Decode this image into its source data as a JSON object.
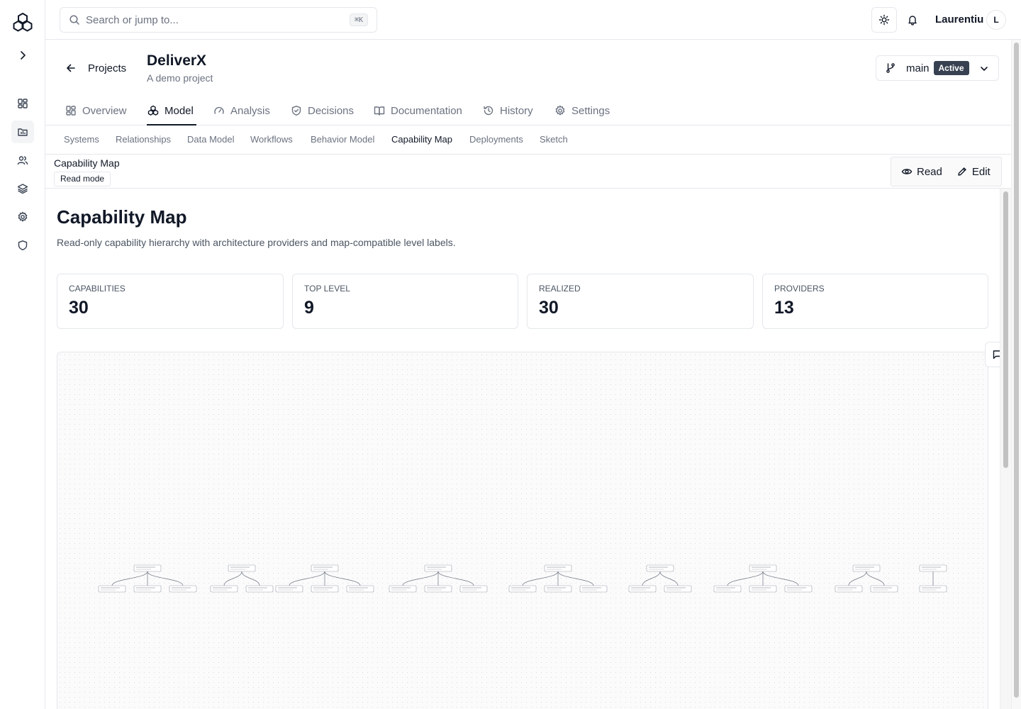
{
  "search": {
    "placeholder": "Search or jump to...",
    "shortcut": "⌘K"
  },
  "user": {
    "name": "Laurentiu",
    "initial": "L"
  },
  "breadcrumb": {
    "back_label": "Projects"
  },
  "project": {
    "name": "DeliverX",
    "description": "A demo project"
  },
  "branch": {
    "name": "main",
    "status": "Active"
  },
  "tabs": [
    {
      "label": "Overview",
      "icon": "layout-icon"
    },
    {
      "label": "Model",
      "icon": "boxes-icon",
      "active": true
    },
    {
      "label": "Analysis",
      "icon": "gauge-icon"
    },
    {
      "label": "Decisions",
      "icon": "shield-check-icon"
    },
    {
      "label": "Documentation",
      "icon": "book-icon"
    },
    {
      "label": "History",
      "icon": "history-icon"
    },
    {
      "label": "Settings",
      "icon": "gear-icon"
    }
  ],
  "subtabs": [
    {
      "label": "Systems"
    },
    {
      "label": "Relationships"
    },
    {
      "label": "Data Model"
    },
    {
      "label": "Workflows"
    },
    {
      "label": "Behavior Model"
    },
    {
      "label": "Capability Map",
      "active": true
    },
    {
      "label": "Deployments"
    },
    {
      "label": "Sketch"
    }
  ],
  "capbar": {
    "title": "Capability Map",
    "mode_badge": "Read mode",
    "read_label": "Read",
    "edit_label": "Edit"
  },
  "page": {
    "title": "Capability Map",
    "description": "Read-only capability hierarchy with architecture providers and map-compatible level labels."
  },
  "stats": [
    {
      "label": "CAPABILITIES",
      "value": "30"
    },
    {
      "label": "TOP LEVEL",
      "value": "9"
    },
    {
      "label": "REALIZED",
      "value": "30"
    },
    {
      "label": "PROVIDERS",
      "value": "13"
    }
  ],
  "map": {
    "groups": 9,
    "children_per_group": [
      3,
      2,
      3,
      3,
      3,
      2,
      3,
      2,
      1
    ]
  },
  "colors": {
    "accent": "#111827",
    "badge_bg": "#374151",
    "border": "#e5e7eb",
    "muted": "#6b7280"
  }
}
